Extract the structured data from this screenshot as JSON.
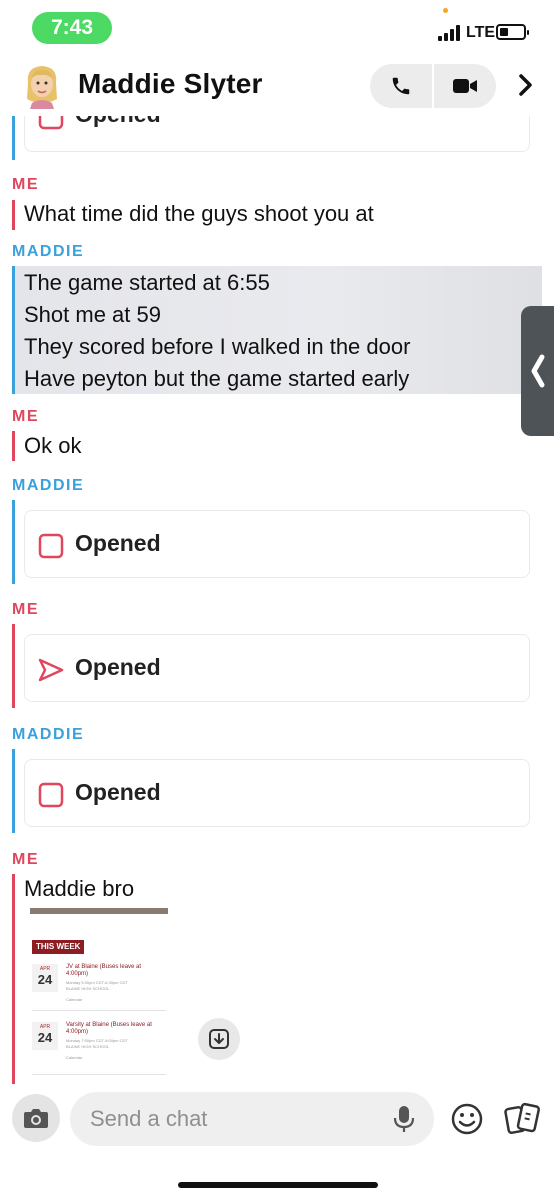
{
  "status_bar": {
    "time": "7:43",
    "carrier": "LTE"
  },
  "header": {
    "contact_name": "Maddie Slyter",
    "avatar_icon": "bitmoji-avatar-icon",
    "call_icon": "phone-icon",
    "video_icon": "video-camera-icon",
    "more_icon": "chevron-right-icon"
  },
  "chat": {
    "top_partial_label": "Opened",
    "senders": {
      "me": "ME",
      "maddie": "MADDIE"
    },
    "messages": [
      {
        "sender": "me",
        "text": "What time did the guys shoot you at"
      },
      {
        "sender": "maddie",
        "lines": [
          "The game started at 6:55",
          "Shot me at 59",
          "They scored before I walked in the door",
          "Have peyton but the game started early"
        ]
      },
      {
        "sender": "me",
        "text": "Ok ok"
      },
      {
        "sender": "maddie",
        "snap": "Opened",
        "icon": "opened-snap-square-icon"
      },
      {
        "sender": "me",
        "snap": "Opened",
        "icon": "opened-sent-arrow-icon"
      },
      {
        "sender": "maddie",
        "snap": "Opened",
        "icon": "opened-snap-square-icon"
      },
      {
        "sender": "me",
        "text": "Maddie bro"
      }
    ],
    "preview": {
      "header": "THIS WEEK",
      "events": [
        {
          "month": "APR",
          "day": "24",
          "title": "JV at Blaine (Buses leave at 4:00pm)",
          "time": "Monday 5:30pm CDT-6:30pm CDT",
          "school": "BLAINE HIGH SCHOOL",
          "tag": "Calendar"
        },
        {
          "month": "APR",
          "day": "24",
          "title": "Varsity at Blaine (Buses leave at 4:00pm)",
          "time": "Monday 7:00pm CDT-9:00pm CDT",
          "school": "BLAINE HIGH SCHOOL",
          "tag": "Calendar"
        }
      ]
    }
  },
  "bottom_bar": {
    "placeholder": "Send a chat",
    "camera_icon": "camera-icon",
    "mic_icon": "microphone-icon",
    "smiley_icon": "smiley-icon",
    "cards_icon": "cards-icon"
  },
  "colors": {
    "me": "#e0475e",
    "maddie": "#3aa1dd",
    "status_green": "#4cd964"
  }
}
